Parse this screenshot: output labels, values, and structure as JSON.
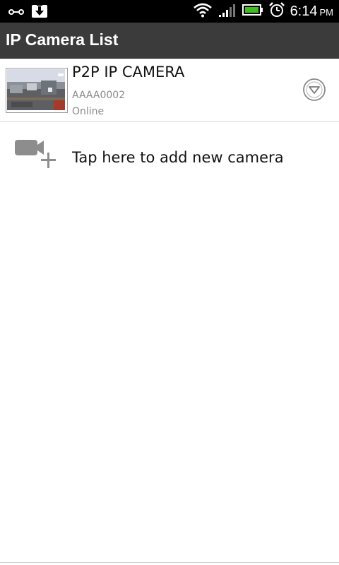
{
  "status_bar": {
    "time": "6:14",
    "ampm": "PM"
  },
  "header": {
    "title": "IP Camera List"
  },
  "cameras": [
    {
      "name": "P2P IP CAMERA",
      "id": "AAAA0002",
      "status": "Online",
      "menu_icon": "chevron-down-circle-icon"
    }
  ],
  "add_camera": {
    "label": "Tap here to add new camera",
    "icon": "add-camera-icon"
  },
  "colors": {
    "status_bar": "#000000",
    "title_bar": "#3b3b3b",
    "secondary_text": "#8a8a8a",
    "battery": "#3fbf1f"
  }
}
